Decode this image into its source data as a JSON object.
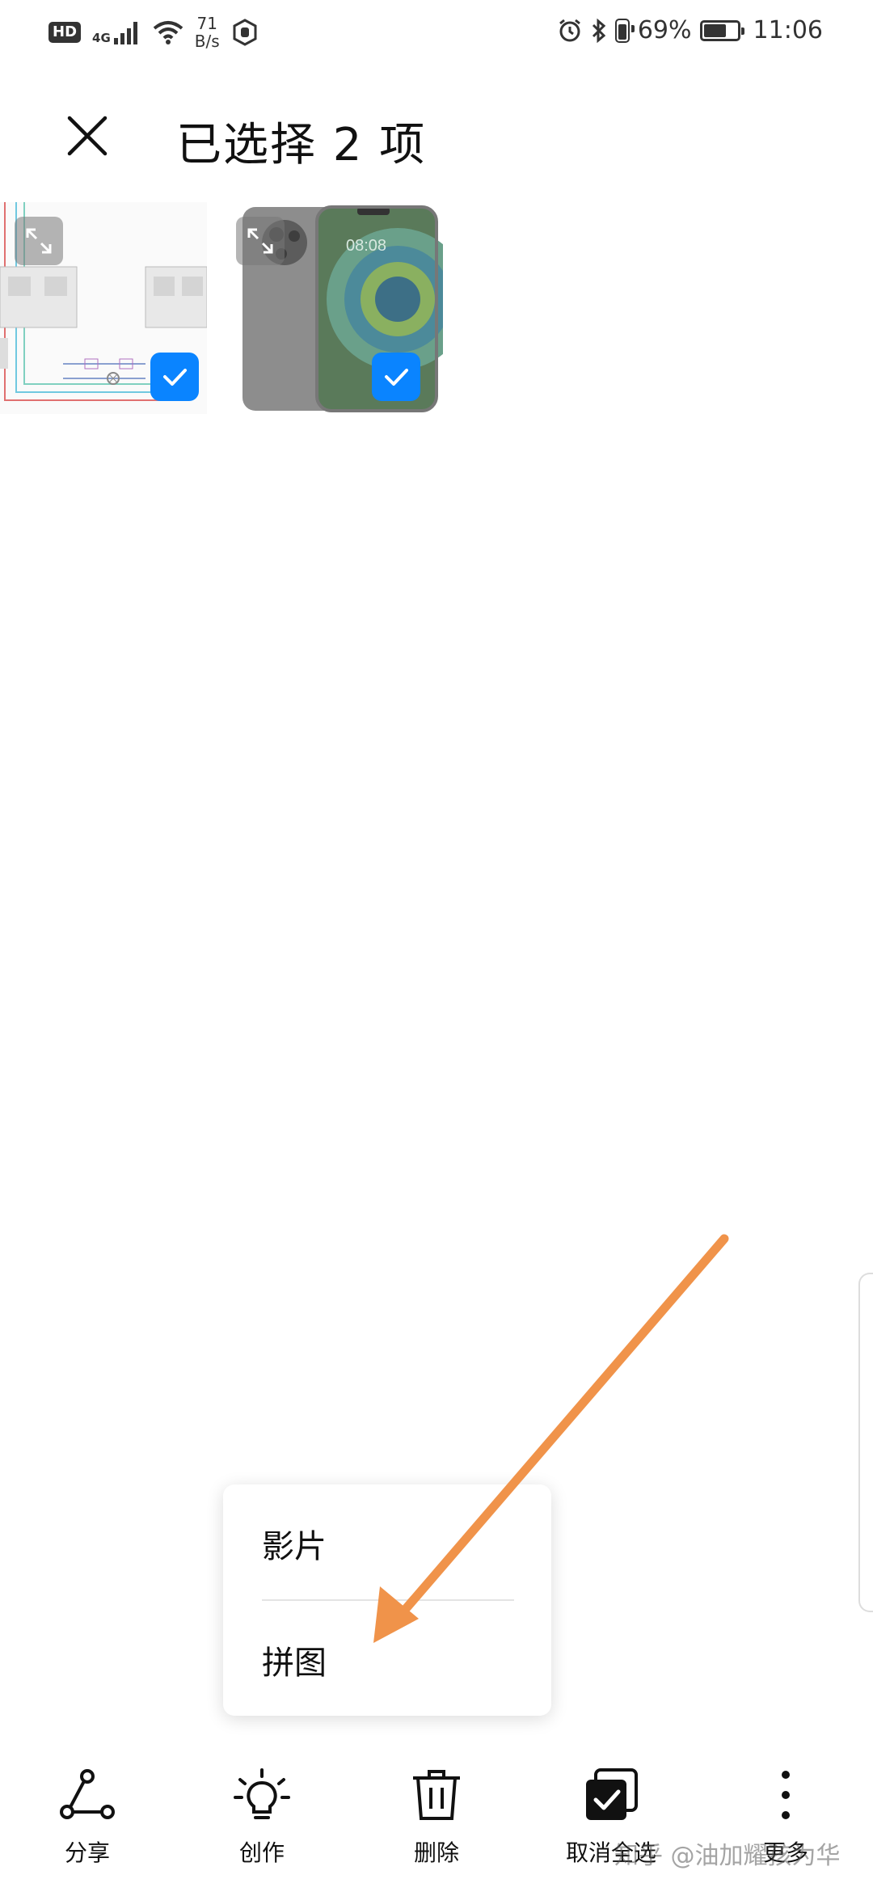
{
  "status_bar": {
    "hd": "HD",
    "network": "4G",
    "speed_value": "71",
    "speed_unit": "B/s",
    "battery_percent": "69%",
    "battery_level": 0.69,
    "time": "11:06"
  },
  "header": {
    "title": "已选择 2 项",
    "close_icon": "close-icon"
  },
  "thumbnails": [
    {
      "name": "circuit-diagram-thumbnail",
      "selected": true
    },
    {
      "name": "phone-photo-thumbnail",
      "selected": true,
      "screen_time": "08:08"
    }
  ],
  "popup_menu": {
    "items": [
      {
        "label": "影片"
      },
      {
        "label": "拼图"
      }
    ]
  },
  "toolbar": {
    "items": [
      {
        "label": "分享",
        "icon": "share-icon"
      },
      {
        "label": "创作",
        "icon": "bulb-icon"
      },
      {
        "label": "删除",
        "icon": "trash-icon"
      },
      {
        "label": "取消全选",
        "icon": "deselect-all-icon"
      },
      {
        "label": "更多",
        "icon": "more-vertical-icon"
      }
    ]
  },
  "watermark": "知乎 @油加耀孩为华",
  "colors": {
    "accent": "#0a84ff",
    "arrow": "#f0934a",
    "text": "#111111"
  }
}
